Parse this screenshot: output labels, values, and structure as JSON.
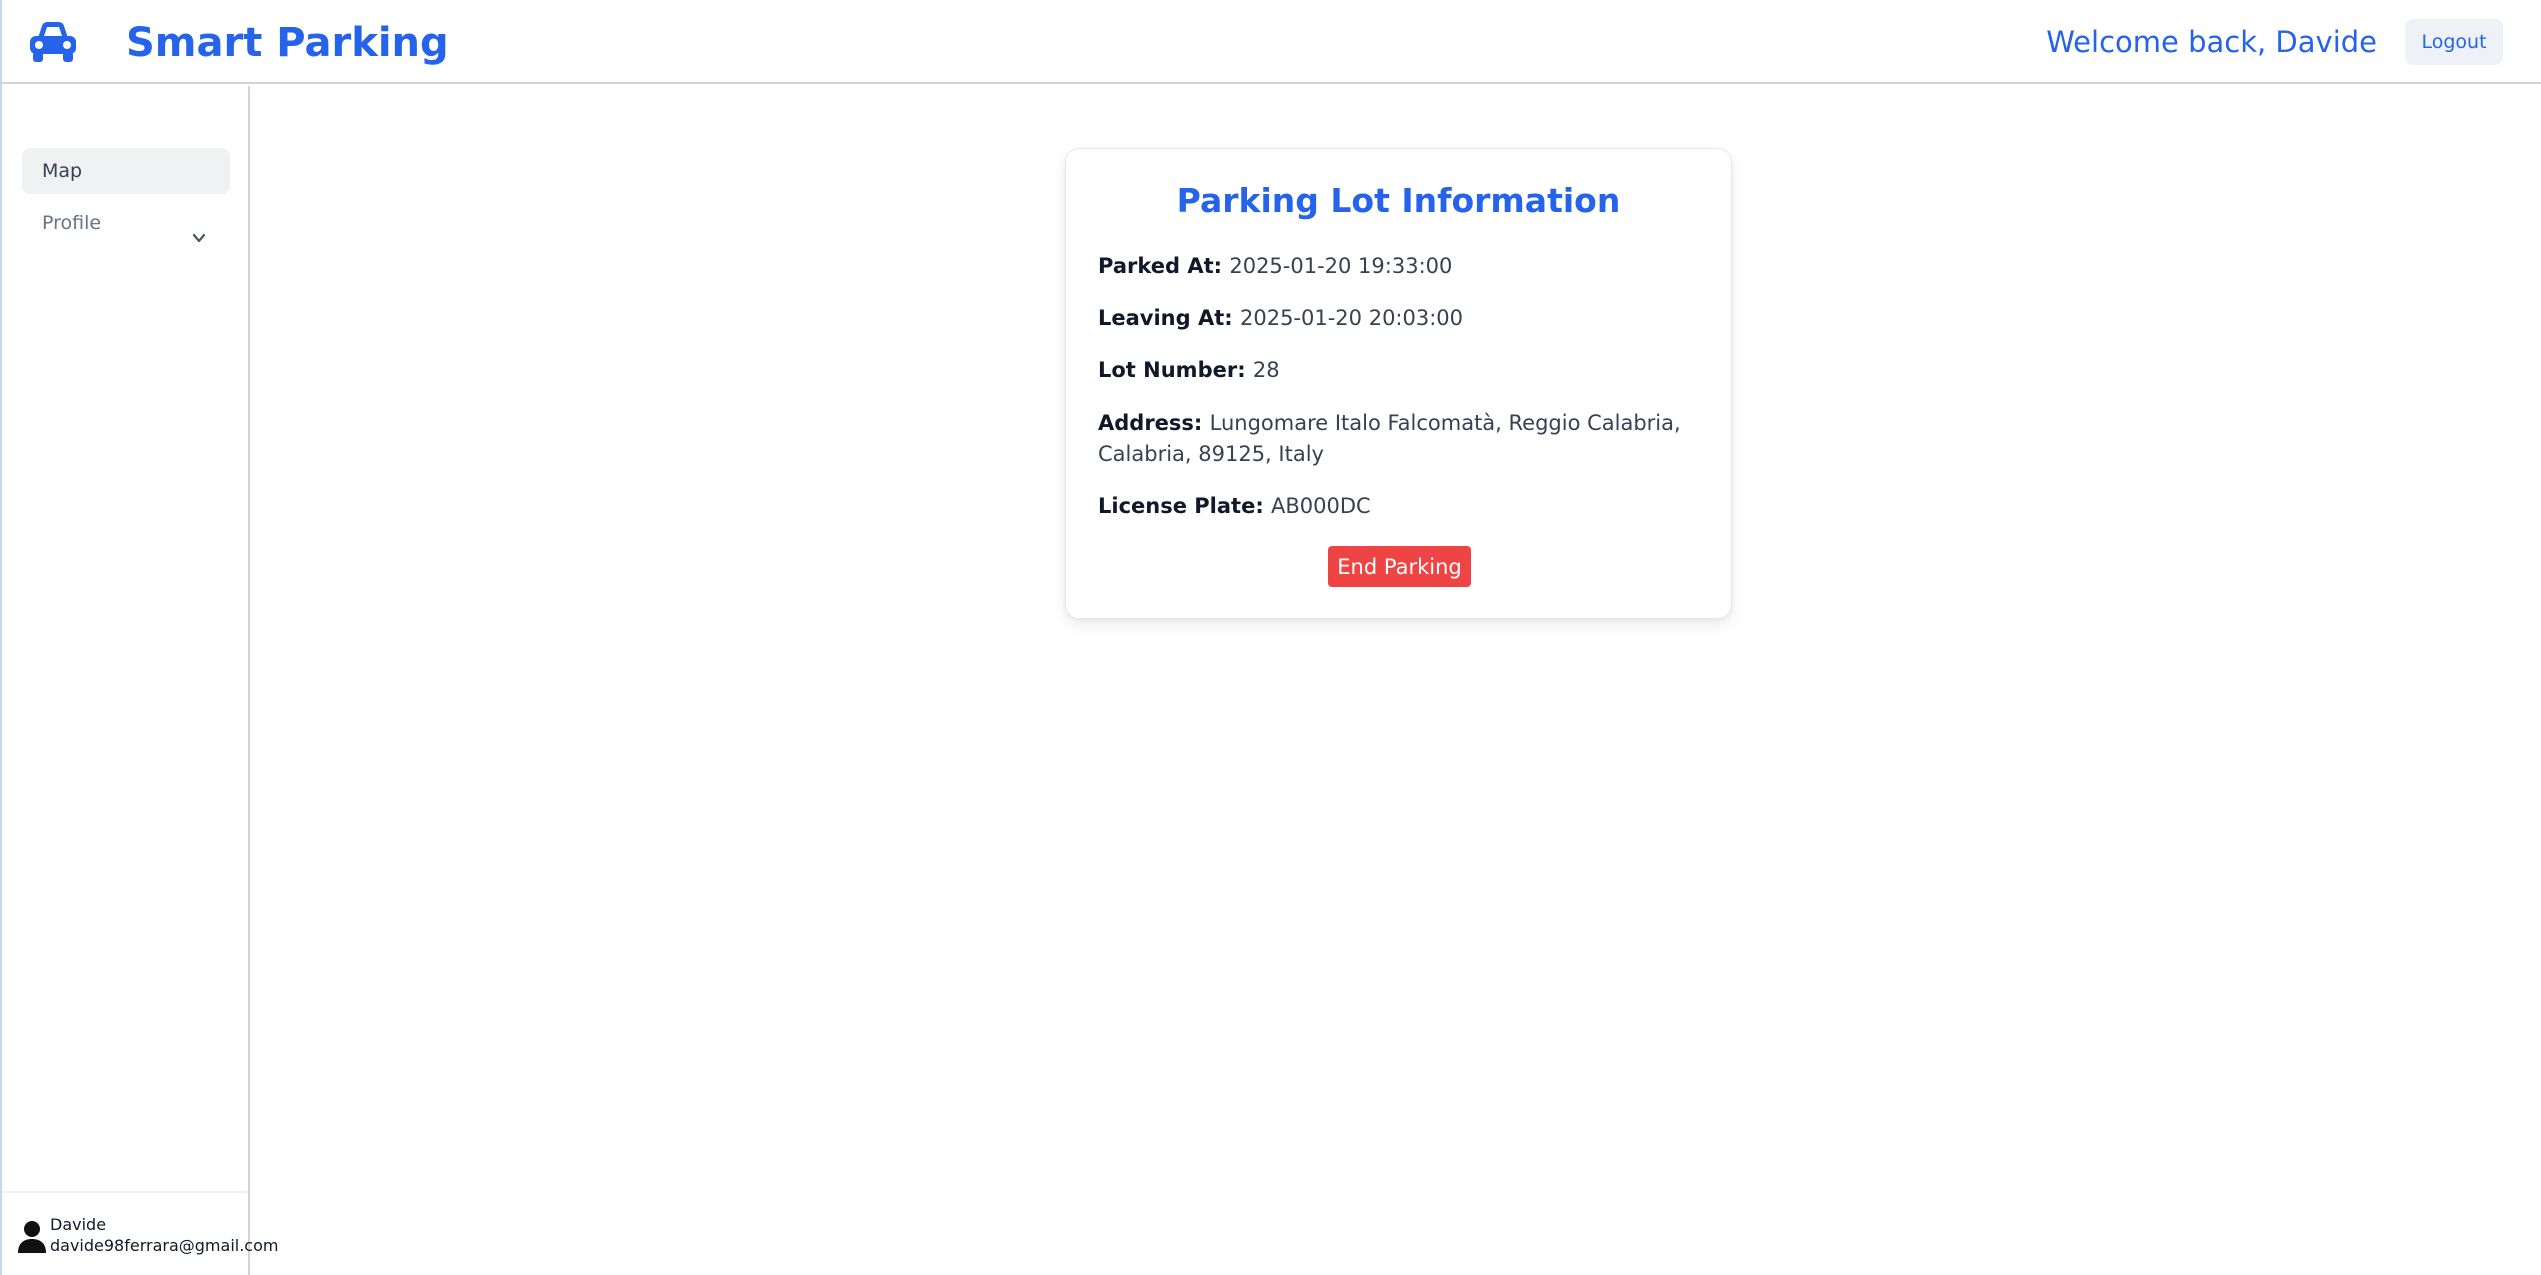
{
  "header": {
    "brand": "Smart Parking",
    "welcome": "Welcome back, Davide",
    "logout_label": "Logout",
    "logo_icon": "car-icon"
  },
  "sidebar": {
    "items": [
      {
        "label": "Map",
        "active": true
      },
      {
        "label": "Profile",
        "icon": "chevron-down-icon"
      }
    ],
    "user": {
      "name": "Davide",
      "email": "davide98ferrara@gmail.com",
      "icon": "user-icon"
    }
  },
  "card": {
    "title": "Parking Lot Information",
    "fields": [
      {
        "label": "Parked At:",
        "value": "2025-01-20 19:33:00"
      },
      {
        "label": "Leaving At:",
        "value": "2025-01-20 20:03:00"
      },
      {
        "label": "Lot Number:",
        "value": "28"
      },
      {
        "label": "Address:",
        "value": "Lungomare Italo Falcomatà, Reggio Calabria, Calabria, 89125, Italy"
      },
      {
        "label": "License Plate:",
        "value": "AB000DC"
      }
    ],
    "end_button_label": "End Parking"
  },
  "colors": {
    "accent": "#2563eb",
    "danger": "#ef4444"
  }
}
